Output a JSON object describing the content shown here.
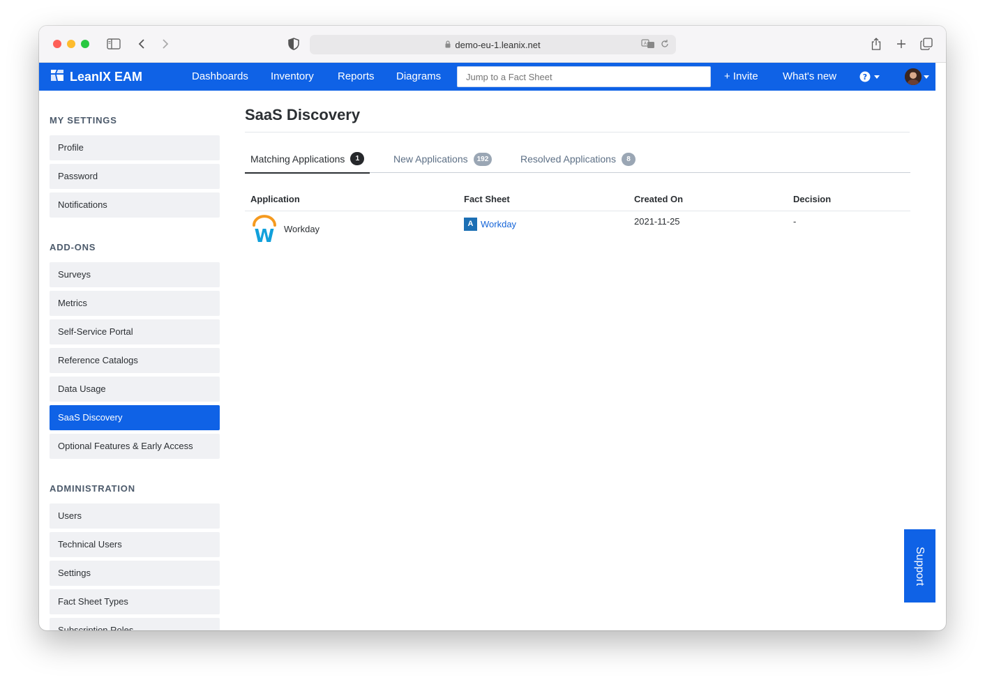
{
  "browser": {
    "url": "demo-eu-1.leanix.net"
  },
  "app": {
    "brand": "LeanIX EAM",
    "nav": [
      "Dashboards",
      "Inventory",
      "Reports",
      "Diagrams"
    ],
    "search_placeholder": "Jump to a Fact Sheet",
    "invite_label": "+ Invite",
    "whats_new_label": "What's new",
    "accent_color": "#0f62e6"
  },
  "sidebar": {
    "sections": [
      {
        "title": "MY SETTINGS",
        "items": [
          "Profile",
          "Password",
          "Notifications"
        ]
      },
      {
        "title": "ADD-ONS",
        "items": [
          "Surveys",
          "Metrics",
          "Self-Service Portal",
          "Reference Catalogs",
          "Data Usage",
          "SaaS Discovery",
          "Optional Features & Early Access"
        ]
      },
      {
        "title": "ADMINISTRATION",
        "items": [
          "Users",
          "Technical Users",
          "Settings",
          "Fact Sheet Types",
          "Subscription Roles"
        ]
      }
    ],
    "active_item": "SaaS Discovery"
  },
  "page": {
    "title": "SaaS Discovery",
    "tabs": [
      {
        "label": "Matching Applications",
        "count": "1"
      },
      {
        "label": "New Applications",
        "count": "192"
      },
      {
        "label": "Resolved Applications",
        "count": "8"
      }
    ],
    "table": {
      "columns": [
        "Application",
        "Fact Sheet",
        "Created On",
        "Decision"
      ],
      "rows": [
        {
          "application": "Workday",
          "fact_sheet_type": "A",
          "fact_sheet": "Workday",
          "created_on": "2021-11-25",
          "decision": "-"
        }
      ]
    }
  },
  "support_label": "Support"
}
